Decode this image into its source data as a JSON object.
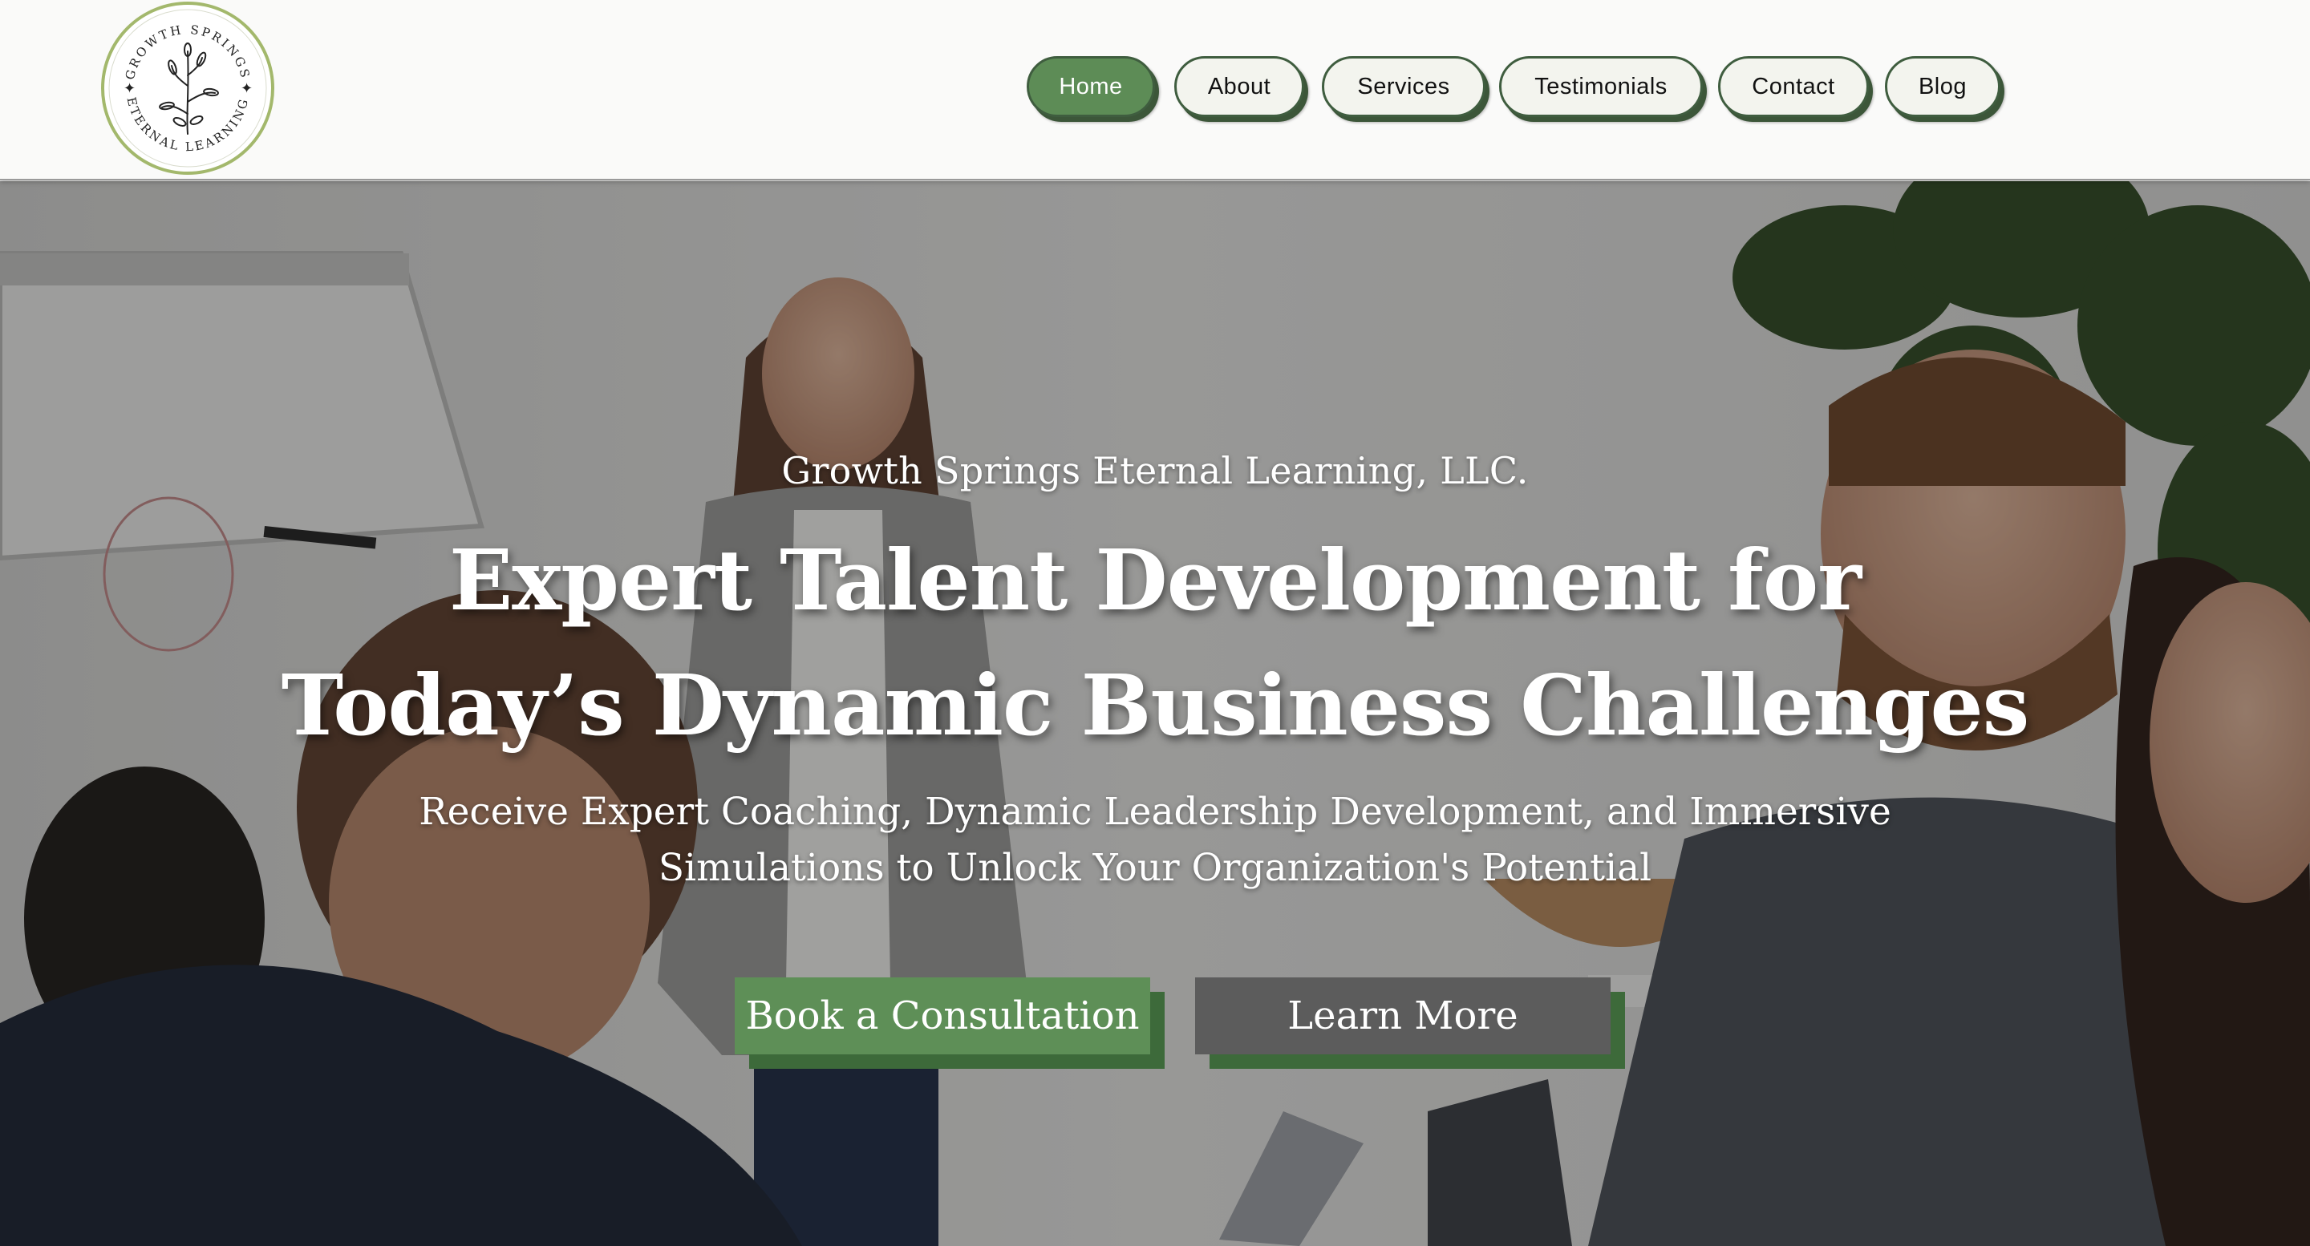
{
  "brand": {
    "logo_text_top": "GROWTH SPRINGS",
    "logo_text_bottom": "ETERNAL LEARNING",
    "logo_icon": "branch-leaves-icon"
  },
  "nav": {
    "items": [
      {
        "label": "Home",
        "active": true
      },
      {
        "label": "About",
        "active": false
      },
      {
        "label": "Services",
        "active": false
      },
      {
        "label": "Testimonials",
        "active": false
      },
      {
        "label": "Contact",
        "active": false
      },
      {
        "label": "Blog",
        "active": false
      }
    ]
  },
  "hero": {
    "company": "Growth Springs Eternal Learning, LLC.",
    "headline_line1": "Expert Talent Development for",
    "headline_line2": "Today’s Dynamic Business Challenges",
    "sub_line1": "Receive Expert Coaching, Dynamic Leadership Development, and Immersive",
    "sub_line2": "Simulations to Unlock Your Organization's Potential",
    "primary_cta": "Book a Consultation",
    "secondary_cta": "Learn More",
    "background_image": "office-meeting-presentation-photo"
  },
  "colors": {
    "brand_green": "#5e8f57",
    "nav_border": "#3f5d3f",
    "button_shadow_green": "#3d6a3a",
    "secondary_button": "#5c5c5c",
    "header_bg": "#fafaf9"
  }
}
